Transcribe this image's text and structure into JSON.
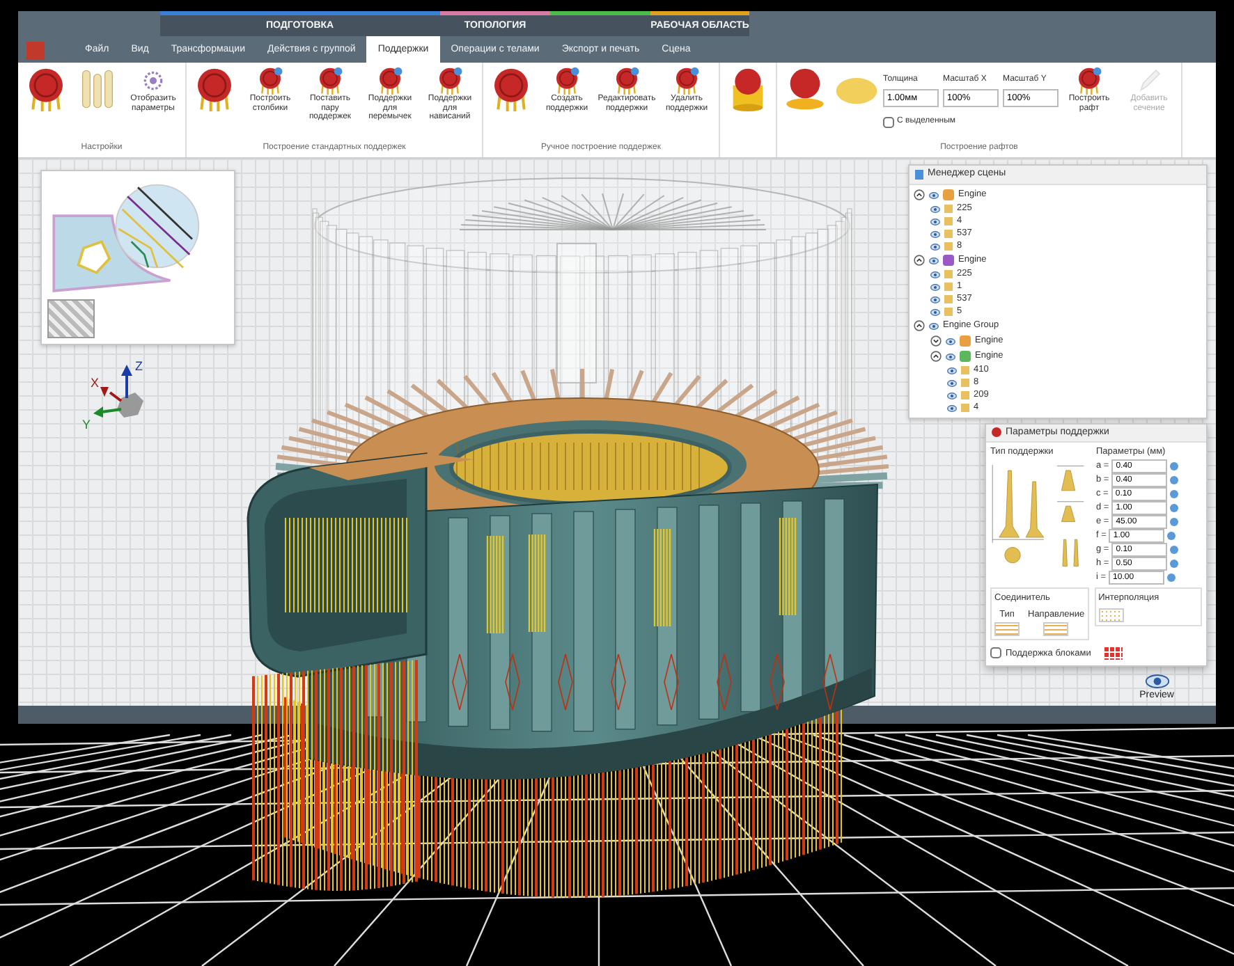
{
  "tab_groups": [
    {
      "tabs": [
        {
          "label": "Файл",
          "selected": false
        },
        {
          "label": "Вид",
          "selected": false
        }
      ]
    },
    {
      "label": "ПОДГОТОВКА",
      "color": "#3a7fd5",
      "tabs": [
        {
          "label": "Трансформации",
          "selected": false
        },
        {
          "label": "Действия с группой",
          "selected": false
        },
        {
          "label": "Поддержки",
          "selected": true
        }
      ]
    },
    {
      "label": "ТОПОЛОГИЯ",
      "color": "#d87aa6",
      "tabs": [
        {
          "label": "Операции с телами",
          "selected": false
        }
      ]
    },
    {
      "color": "#4cbb4c",
      "tabs": [
        {
          "label": "Экспорт и печать",
          "selected": false
        }
      ]
    },
    {
      "label": "РАБОЧАЯ ОБЛАСТЬ",
      "color": "#e0a020",
      "tabs": [
        {
          "label": "Сцена",
          "selected": false
        }
      ]
    }
  ],
  "ribbon": [
    {
      "label": "Настройки",
      "items": [
        {
          "kind": "sphere"
        },
        {
          "kind": "pins"
        },
        {
          "kind": "gear",
          "label": "Отобразить параметры"
        }
      ]
    },
    {
      "label": "Построение стандартных поддержек",
      "items": [
        {
          "kind": "sphere"
        },
        {
          "kind": "marker",
          "label": "Построить столбики"
        },
        {
          "kind": "marker",
          "label": "Поставить пару поддержек"
        },
        {
          "kind": "marker",
          "label": "Поддержки для перемычек"
        },
        {
          "kind": "marker",
          "label": "Поддержки для нависаний"
        }
      ]
    },
    {
      "label": "Ручное построение поддержек",
      "items": [
        {
          "kind": "sphere"
        },
        {
          "kind": "marker",
          "label": "Создать поддержки"
        },
        {
          "kind": "marker",
          "label": "Редактировать поддержки"
        },
        {
          "kind": "marker",
          "label": "Удалить поддержки"
        }
      ]
    },
    {
      "items": [
        {
          "kind": "cylinder"
        }
      ]
    },
    {
      "label": "Построение рафтов",
      "items": [
        {
          "kind": "disc"
        },
        {
          "kind": "oval"
        },
        {
          "kind": "field",
          "label": "Толщина",
          "value": "1.00мм"
        },
        {
          "kind": "field",
          "label": "Масштаб X",
          "value": "100%"
        },
        {
          "kind": "field",
          "label": "Масштаб Y",
          "value": "100%"
        },
        {
          "kind": "check",
          "label": "С выделенным",
          "checked": false
        },
        {
          "kind": "marker",
          "label": "Построить рафт"
        },
        {
          "kind": "pen",
          "label": "Добавить сечение",
          "disabled": true
        }
      ]
    }
  ],
  "scene_manager": {
    "title": "Менеджер сцены",
    "items": [
      {
        "label": "Engine",
        "expanded": true,
        "color": "#e8a040",
        "children": [
          {
            "count": "225"
          },
          {
            "count": "4"
          },
          {
            "count": "537"
          },
          {
            "count": "8"
          }
        ]
      },
      {
        "label": "Engine",
        "expanded": true,
        "color": "#9b59c6",
        "children": [
          {
            "count": "225"
          },
          {
            "count": "1"
          },
          {
            "count": "537"
          },
          {
            "count": "5"
          }
        ]
      },
      {
        "label": "Engine Group",
        "expanded": true,
        "children": [
          {
            "label": "Engine",
            "expanded": false,
            "color": "#e8a040"
          },
          {
            "label": "Engine",
            "expanded": true,
            "color": "#5cb85c",
            "children": [
              {
                "count": "410"
              },
              {
                "count": "8"
              },
              {
                "count": "209"
              },
              {
                "count": "4"
              }
            ]
          }
        ]
      }
    ]
  },
  "support_params": {
    "title": "Параметры поддержки",
    "type_label": "Тип поддержки",
    "params_label": "Параметры (мм)",
    "params": [
      {
        "name": "a =",
        "value": "0.40"
      },
      {
        "name": "b =",
        "value": "0.40"
      },
      {
        "name": "c =",
        "value": "0.10"
      },
      {
        "name": "d =",
        "value": "1.00"
      },
      {
        "name": "e =",
        "value": "45.00"
      },
      {
        "name": "f =",
        "value": "1.00"
      },
      {
        "name": "g =",
        "value": "0.10"
      },
      {
        "name": "h =",
        "value": "0.50"
      },
      {
        "name": "i =",
        "value": "10.00"
      }
    ],
    "connector_label": "Соединитель",
    "connector_fields": [
      "Тип",
      "Направление"
    ],
    "interp_label": "Интерполяция",
    "block_check": {
      "label": "Поддержка блоками",
      "checked": false
    }
  },
  "preview": {
    "label": "Preview"
  },
  "axes": [
    "X",
    "Y",
    "Z"
  ]
}
